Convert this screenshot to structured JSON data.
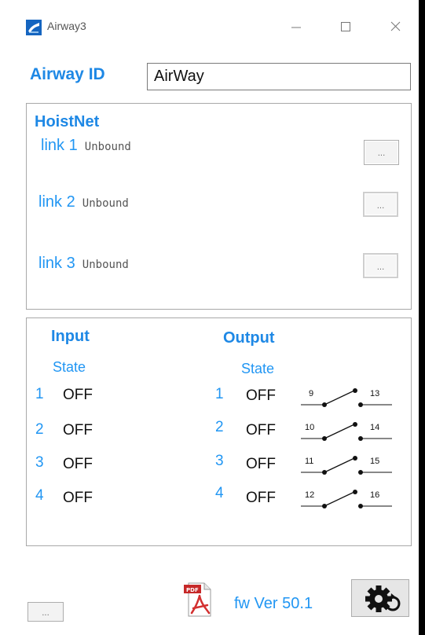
{
  "window": {
    "title": "Airway3",
    "icon": "airway-app-icon",
    "controls": [
      "minimize-icon",
      "maximize-icon",
      "close-icon"
    ]
  },
  "airway": {
    "label": "Airway ID",
    "value": "AirWay"
  },
  "hoistnet": {
    "title": "HoistNet",
    "links": [
      {
        "label": "link 1",
        "status": "Unbound",
        "button": "..."
      },
      {
        "label": "link 2",
        "status": "Unbound",
        "button": "..."
      },
      {
        "label": "link 3",
        "status": "Unbound",
        "button": "..."
      }
    ]
  },
  "io": {
    "input_title": "Input",
    "input_sub": "State",
    "output_title": "Output",
    "output_sub": "State",
    "inputs": [
      {
        "num": "1",
        "state": "OFF"
      },
      {
        "num": "2",
        "state": "OFF"
      },
      {
        "num": "3",
        "state": "OFF"
      },
      {
        "num": "4",
        "state": "OFF"
      }
    ],
    "outputs": [
      {
        "num": "1",
        "state": "OFF",
        "pin_a": "9",
        "pin_b": "13"
      },
      {
        "num": "2",
        "state": "OFF",
        "pin_a": "10",
        "pin_b": "14"
      },
      {
        "num": "3",
        "state": "OFF",
        "pin_a": "11",
        "pin_b": "15"
      },
      {
        "num": "4",
        "state": "OFF",
        "pin_a": "12",
        "pin_b": "16"
      }
    ]
  },
  "footer": {
    "small_button": "...",
    "pdf_icon": "pdf-icon",
    "fw_label": "fw Ver",
    "fw_value": "50.1",
    "settings_icon": "gear-refresh-icon"
  },
  "colors": {
    "accent": "#1e88e5",
    "link": "#2196f3",
    "border": "#a8a8a8"
  }
}
